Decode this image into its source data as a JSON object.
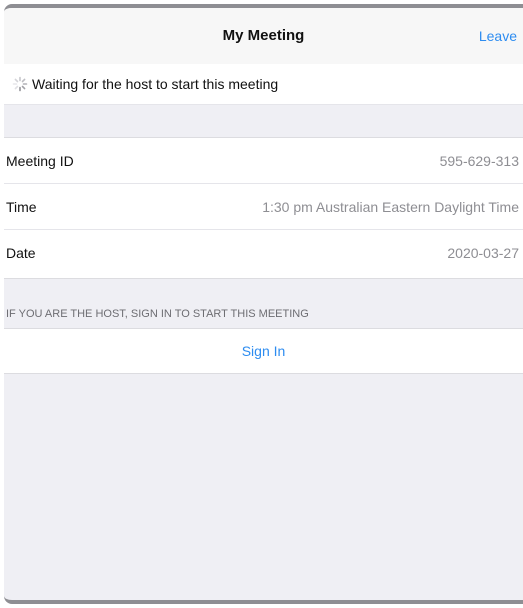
{
  "header": {
    "title": "My Meeting",
    "leave_label": "Leave"
  },
  "status": {
    "icon": "loading-spinner-icon",
    "text": "Waiting for the host to start this meeting"
  },
  "details": {
    "meeting_id_label": "Meeting ID",
    "meeting_id_value": "595-629-313",
    "time_label": "Time",
    "time_value": "1:30 pm Australian Eastern Daylight Time",
    "date_label": "Date",
    "date_value": "2020-03-27"
  },
  "host_section": {
    "header": "IF YOU ARE THE HOST, SIGN IN TO START THIS MEETING",
    "sign_in_label": "Sign In"
  },
  "colors": {
    "accent": "#2d8cf0",
    "background": "#efeff4",
    "secondary_text": "#8e8e93"
  }
}
